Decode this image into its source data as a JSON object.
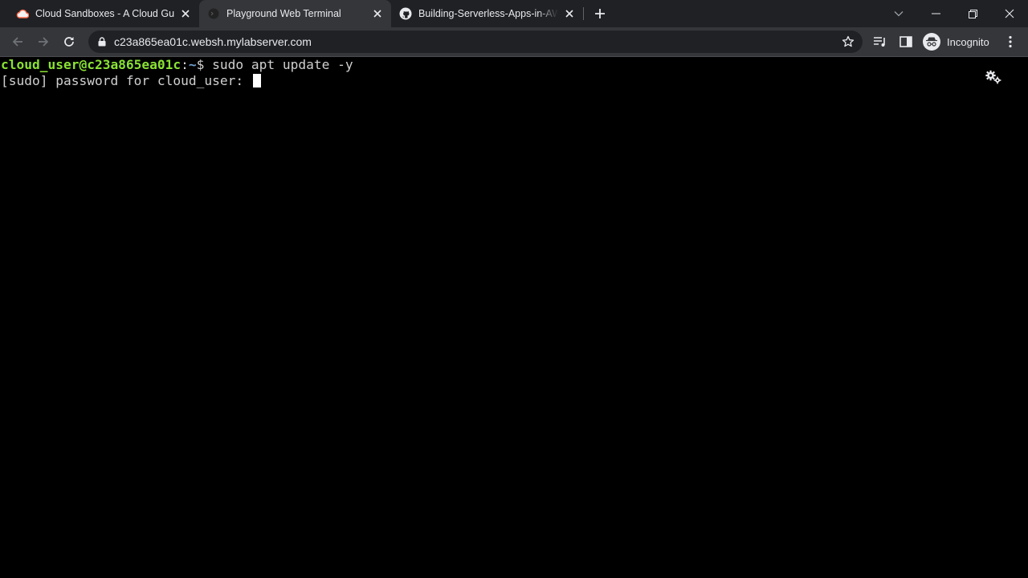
{
  "browser": {
    "tabs": [
      {
        "title": "Cloud Sandboxes - A Cloud Guru",
        "icon": "cloud-icon",
        "active": false
      },
      {
        "title": "Playground Web Terminal",
        "icon": "terminal-favicon-icon",
        "active": true
      },
      {
        "title": "Building-Serverless-Apps-in-AWS",
        "icon": "github-icon",
        "active": false
      }
    ],
    "url": "c23a865ea01c.websh.mylabserver.com",
    "profile_label": "Incognito",
    "colors": {
      "tabstrip": "#202124",
      "toolbar": "#35363a",
      "text": "#e8eaed"
    }
  },
  "terminal": {
    "prompt_user": "cloud_user@c23a865ea01c",
    "prompt_sep": ":",
    "prompt_path": "~",
    "prompt_symbol": "$ ",
    "command": "sudo apt update -y",
    "output": "[sudo] password for cloud_user: ",
    "colors": {
      "background": "#000000",
      "prompt_user": "#8ae234",
      "text": "#d0d0d0"
    }
  }
}
